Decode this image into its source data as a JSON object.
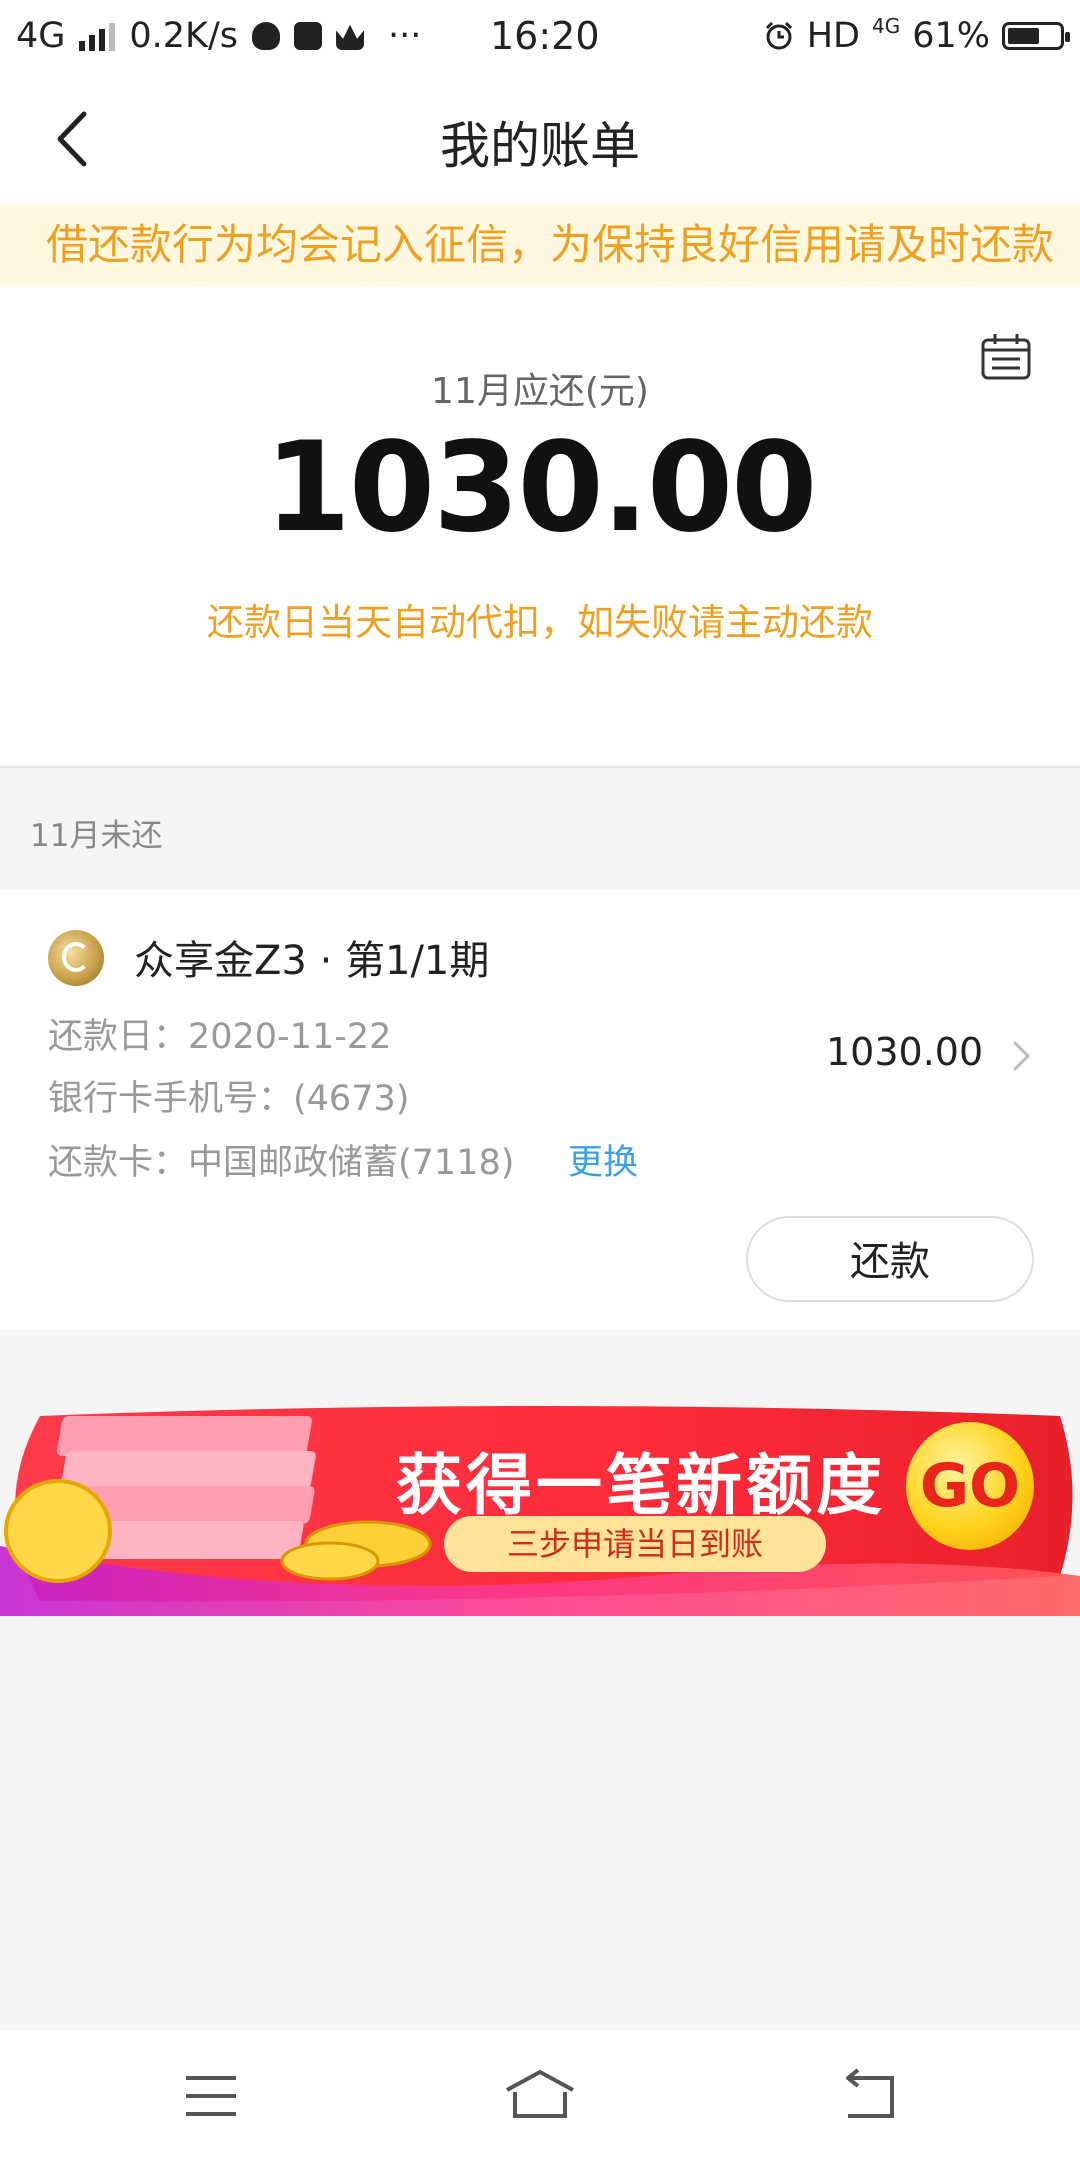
{
  "status_bar": {
    "network": "4G",
    "speed": "0.2K/s",
    "dots": "···",
    "time": "16:20",
    "hd": "HD",
    "net_type": "4G",
    "battery_text": "61%",
    "battery_level": 0.61
  },
  "header": {
    "title": "我的账单"
  },
  "notice": {
    "text": "借还款行为均会记入征信，为保持良好信用请及时还款"
  },
  "summary": {
    "label": "11月应还(元)",
    "amount": "1030.00",
    "note": "还款日当天自动代扣，如失败请主动还款"
  },
  "section": {
    "label": "11月未还"
  },
  "bill": {
    "product": "众享金Z3 · 第1/1期",
    "due_date": "还款日：2020-11-22",
    "bank_phone": "银行卡手机号：(4673)",
    "card": "还款卡：中国邮政储蓄(7118)",
    "change_label": "更换",
    "amount": "1030.00",
    "pay_label": "还款"
  },
  "banner": {
    "title": "获得一笔新额度",
    "subtitle": "三步申请当日到账",
    "go": "GO"
  },
  "colors": {
    "accent": "#f0a020",
    "link": "#3aa0e8",
    "banner_red": "#ff2b3a",
    "banner_purple": "#c21fd0"
  }
}
